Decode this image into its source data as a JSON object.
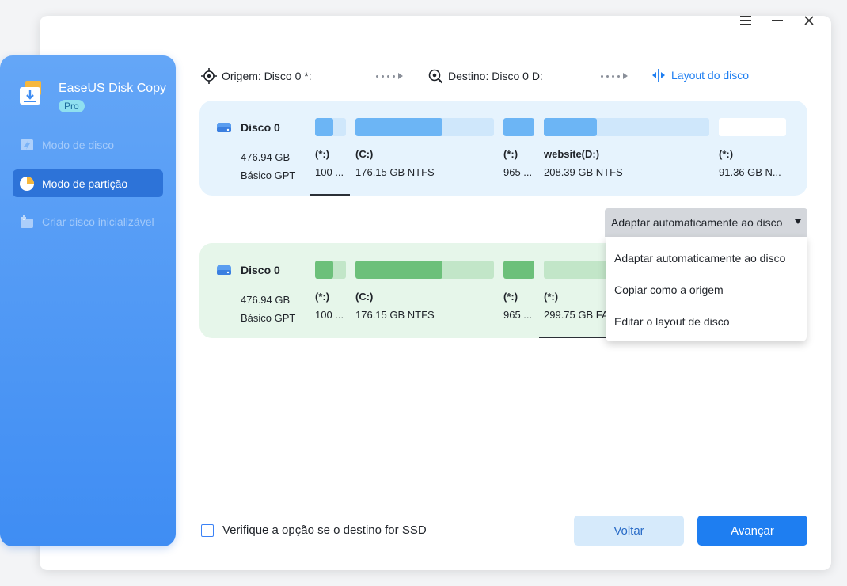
{
  "app": {
    "name": "EaseUS Disk Copy",
    "badge": "Pro"
  },
  "window_controls": {
    "menu_icon": "hamburger-icon",
    "minimize_icon": "minimize-icon",
    "close_icon": "close-icon"
  },
  "sidebar": {
    "items": [
      {
        "label": "Modo de disco",
        "icon": "disk-mode-icon",
        "state": "disabled"
      },
      {
        "label": "Modo de partição",
        "icon": "pie-partition-icon",
        "state": "active"
      },
      {
        "label": "Criar disco inicializável",
        "icon": "bootable-disk-icon",
        "state": "disabled"
      }
    ]
  },
  "toolbar": {
    "source_label": "Origem: Disco 0 *:",
    "dest_label": "Destino: Disco 0 D:",
    "layout_label": "Layout do disco"
  },
  "source_disk": {
    "name": "Disco 0",
    "size": "476.94 GB",
    "type": "Básico GPT",
    "partitions": [
      {
        "label": "(*:)",
        "size": "100 ...",
        "fill": 0.6
      },
      {
        "label": "(C:)",
        "size": "176.15 GB NTFS",
        "fill": 0.63
      },
      {
        "label": "(*:)",
        "size": "965 ...",
        "fill": 1.0
      },
      {
        "label": "website(D:)",
        "size": "208.39 GB NTFS",
        "fill": 0.32
      },
      {
        "label": "(*:)",
        "size": "91.36 GB N...",
        "fill": 0.0
      }
    ]
  },
  "dest_disk": {
    "name": "Disco 0",
    "size": "476.94 GB",
    "type": "Básico GPT",
    "partitions": [
      {
        "label": "(*:)",
        "size": "100 ...",
        "fill": 0.6
      },
      {
        "label": "(C:)",
        "size": "176.15 GB NTFS",
        "fill": 0.63
      },
      {
        "label": "(*:)",
        "size": "965 ...",
        "fill": 1.0
      },
      {
        "label": "(*:)",
        "size": "299.75 GB FA",
        "fill": 0.0
      }
    ]
  },
  "layout_dropdown": {
    "selected": "Adaptar automaticamente ao disco",
    "options": [
      "Adaptar automaticamente ao disco",
      "Copiar como a origem",
      "Editar o layout de disco"
    ]
  },
  "footer": {
    "ssd_checkbox_label": "Verifique a opção se o destino for SSD",
    "ssd_checked": false,
    "back_label": "Voltar",
    "next_label": "Avançar"
  },
  "colors": {
    "accent": "#1e7ef1",
    "src_used": "#6cb5f5",
    "src_free": "#cfe7fb",
    "dst_used": "#6cc07a",
    "dst_free": "#c2e6c8"
  }
}
